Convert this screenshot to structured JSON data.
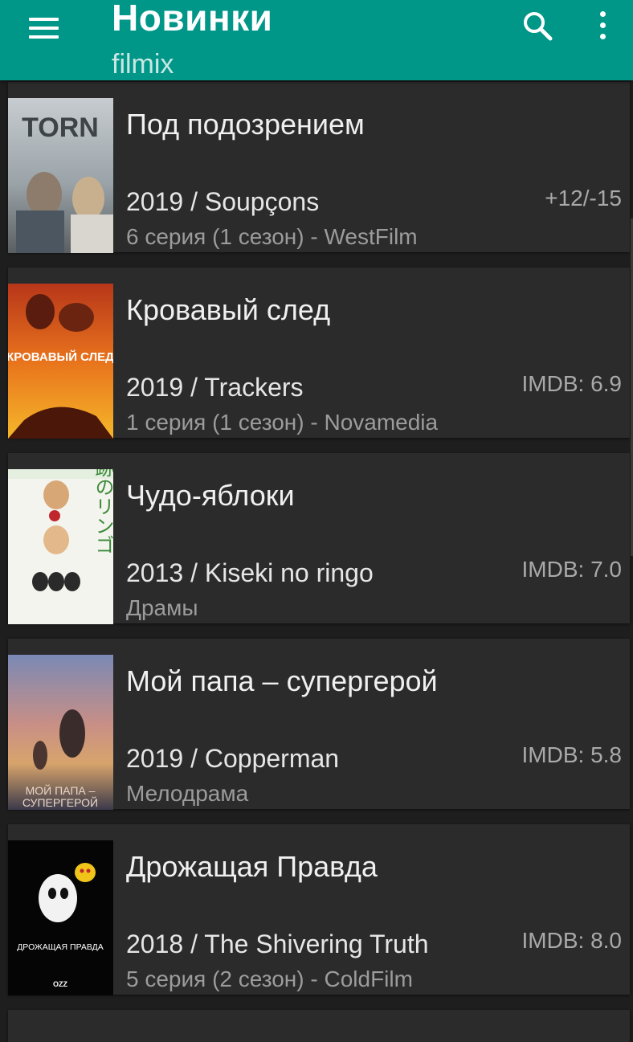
{
  "appbar": {
    "title": "Новинки",
    "subtitle": "filmix",
    "menu_icon": "hamburger-menu-icon",
    "search_icon": "search-icon",
    "more_icon": "more-vert-icon",
    "background": "#009688"
  },
  "movies": [
    {
      "title": "Под подозрением",
      "meta": "2019 / Soupçons",
      "rating": "+12/-15",
      "sub": "6 серия (1 сезон) - WestFilm",
      "poster_text": "TORN"
    },
    {
      "title": "Кровавый след",
      "meta": "2019 / Trackers",
      "rating": "IMDB: 6.9",
      "sub": "1 серия (1 сезон) - Novamedia",
      "poster_text": "КРОВАВЫЙ СЛЕД"
    },
    {
      "title": "Чудо-яблоки",
      "meta": "2013 / Kiseki no ringo",
      "rating": "IMDB: 7.0",
      "sub": "Драмы",
      "poster_text": "奇跡のリンゴ"
    },
    {
      "title": "Мой папа – супергерой",
      "meta": "2019 / Copperman",
      "rating": "IMDB: 5.8",
      "sub": "Мелодрама",
      "poster_text_1": "МОЙ ПАПА –",
      "poster_text_2": "СУПЕРГЕРОЙ"
    },
    {
      "title": "Дрожащая Правда",
      "meta": "2018 / The Shivering Truth",
      "rating": "IMDB: 8.0",
      "sub": "5 серия (2 сезон) - ColdFilm",
      "poster_text": "ДРОЖАЩАЯ ПРАВДА",
      "poster_logo": "OZZ"
    }
  ]
}
